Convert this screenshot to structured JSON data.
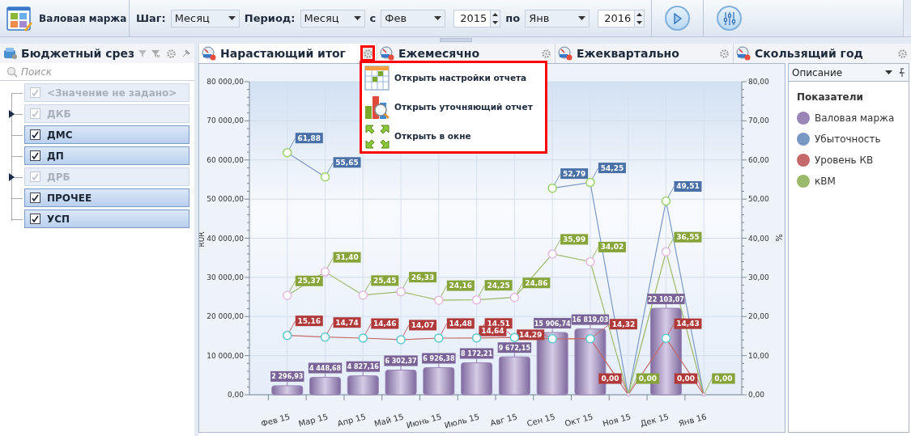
{
  "toolbar": {
    "title": "Валовая маржа",
    "fields": [
      {
        "kind": "select",
        "label": "Шаг:",
        "value": "Месяц"
      },
      {
        "kind": "select",
        "label": "Период:",
        "value": "Месяц"
      },
      {
        "kind": "select",
        "label": "с",
        "value": "Фев"
      },
      {
        "kind": "spin",
        "value": "2015"
      },
      {
        "kind": "select",
        "label": "по",
        "value": "Янв"
      },
      {
        "kind": "spin",
        "value": "2016"
      }
    ]
  },
  "left_panel": {
    "title": "Бюджетный срез",
    "search": {
      "placeholder": "Поиск"
    },
    "items": [
      {
        "label": "<Значение не задано>",
        "checked": true,
        "disabled": true,
        "expandable": false
      },
      {
        "label": "ДКБ",
        "checked": true,
        "disabled": true,
        "expandable": true
      },
      {
        "label": "ДМС",
        "checked": true,
        "disabled": false,
        "expandable": false
      },
      {
        "label": "ДП",
        "checked": true,
        "disabled": false,
        "expandable": false
      },
      {
        "label": "ДРБ",
        "checked": true,
        "disabled": true,
        "expandable": true
      },
      {
        "label": "ПРОЧЕЕ",
        "checked": true,
        "disabled": false,
        "expandable": false
      },
      {
        "label": "УСП",
        "checked": true,
        "disabled": false,
        "expandable": false
      }
    ]
  },
  "tabs": [
    {
      "label": "Нарастающий итог",
      "selected": true
    },
    {
      "label": "Ежемесячно",
      "selected": false
    },
    {
      "label": "Ежеквартально",
      "selected": false
    },
    {
      "label": "Скользящий год",
      "selected": false
    }
  ],
  "context_menu": {
    "items": [
      {
        "kind": "settings",
        "label": "Открыть настройки отчета"
      },
      {
        "kind": "drill",
        "label": "Открыть уточняющий отчет"
      },
      {
        "kind": "window",
        "label": "Открыть в окне"
      }
    ]
  },
  "chart": {
    "chart_data": {
      "type": "bar",
      "ylabel": "RUR",
      "y2label": "%",
      "grid": true,
      "categories": [
        "Фев 15",
        "Мар 15",
        "Апр 15",
        "Май 15",
        "Июнь 15",
        "Июль 15",
        "Авг 15",
        "Сен 15",
        "Окт 15",
        "Ноя 15",
        "Дек 15",
        "Янв 16"
      ],
      "ylim": [
        0,
        80000
      ],
      "y2lim": [
        0,
        80
      ],
      "yticks": [
        {
          "value": 0,
          "label": "0,00"
        },
        {
          "value": 10000,
          "label": "10 000,00"
        },
        {
          "value": 20000,
          "label": "20 000,00"
        },
        {
          "value": 30000,
          "label": "30 000,00"
        },
        {
          "value": 40000,
          "label": "40 000,00"
        },
        {
          "value": 50000,
          "label": "50 000,00"
        },
        {
          "value": 60000,
          "label": "60 000,00"
        },
        {
          "value": 70000,
          "label": "70 000,00"
        },
        {
          "value": 80000,
          "label": "80 000,00"
        }
      ],
      "y2ticks": [
        {
          "value": 0,
          "label": "0,00"
        },
        {
          "value": 10,
          "label": "10,00"
        },
        {
          "value": 20,
          "label": "20,00"
        },
        {
          "value": 30,
          "label": "30,00"
        },
        {
          "value": 40,
          "label": "40,00"
        },
        {
          "value": 50,
          "label": "50,00"
        },
        {
          "value": 60,
          "label": "60,00"
        },
        {
          "value": 70,
          "label": "70,00"
        },
        {
          "value": 80,
          "label": "80,00"
        }
      ],
      "series": [
        {
          "name": "Валовая маржа",
          "type": "bar",
          "color": "#9a86b6",
          "values": [
            2296.93,
            4448.68,
            4827.16,
            6302.37,
            6926.38,
            8172.21,
            9672.15,
            15906.74,
            16819.03,
            null,
            22103.07,
            null
          ],
          "value_labels": [
            "2 296,93",
            "4 448,68",
            "4 827,16",
            "6 302,37",
            "6 926,38",
            "8 172,21",
            "9 672,15",
            "15 906,74",
            "16 819,03",
            null,
            "22 103,07",
            null
          ]
        },
        {
          "name": "Убыточность",
          "type": "line",
          "axis": "y2",
          "marker": "circle",
          "color": "#7a98c4",
          "values": [
            61.88,
            55.65,
            null,
            null,
            null,
            null,
            null,
            52.79,
            54.25,
            0,
            49.51,
            0
          ],
          "value_labels": [
            "61,88",
            "55,65",
            null,
            null,
            null,
            null,
            null,
            "52,79",
            "54,25",
            null,
            "49,51",
            null
          ]
        },
        {
          "name": "Уровень КВ",
          "type": "line",
          "axis": "y2",
          "marker": "circle",
          "color": "#c46a6a",
          "values": [
            15.16,
            14.74,
            14.46,
            14.07,
            14.48,
            14.51,
            14.64,
            14.29,
            14.32,
            0,
            14.43,
            0
          ],
          "value_labels": [
            "15,16",
            "14,74",
            "14,46",
            "14,07",
            "14,48",
            "14,51",
            "14,64",
            "14,29",
            "14,32",
            "0,00",
            "14,43",
            "0,00"
          ]
        },
        {
          "name": "кВМ",
          "type": "line",
          "axis": "y2",
          "marker": "circle",
          "color": "#9cb86a",
          "values": [
            25.37,
            31.4,
            25.45,
            26.33,
            24.16,
            24.25,
            24.86,
            35.99,
            34.02,
            0,
            36.55,
            0
          ],
          "value_labels": [
            "25,37",
            "31,40",
            "25,45",
            "26,33",
            "24,16",
            "24,25",
            "24,86",
            "35,99",
            "34,02",
            "0,00",
            "36,55",
            "0,00"
          ]
        }
      ]
    }
  },
  "legend": {
    "header": "Описание",
    "title": "Показатели"
  }
}
